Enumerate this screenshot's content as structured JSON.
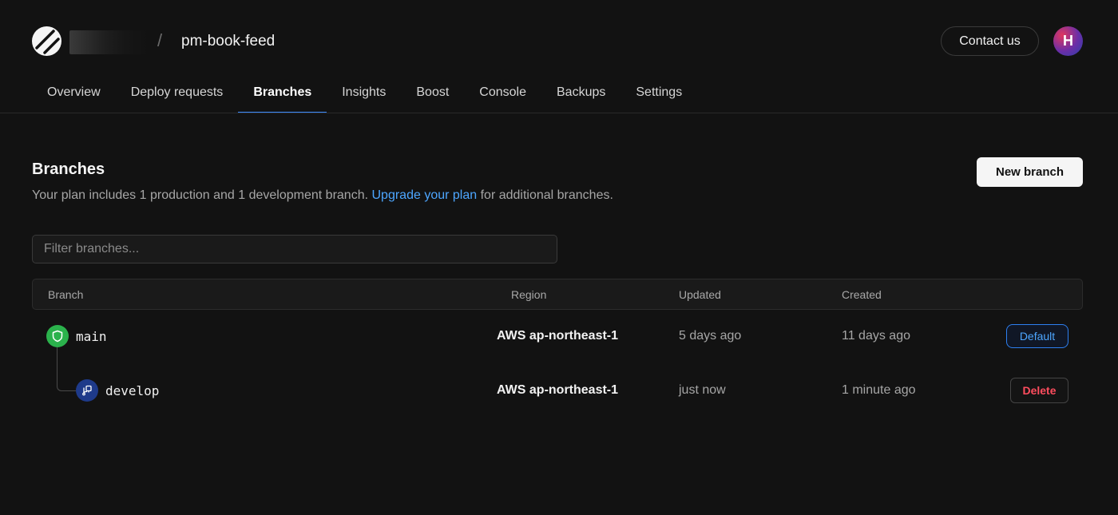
{
  "header": {
    "org_name": "",
    "separator": "/",
    "database": "pm-book-feed",
    "contact_label": "Contact us",
    "avatar_initial": "H"
  },
  "tabs": [
    {
      "label": "Overview",
      "active": false
    },
    {
      "label": "Deploy requests",
      "active": false
    },
    {
      "label": "Branches",
      "active": true
    },
    {
      "label": "Insights",
      "active": false
    },
    {
      "label": "Boost",
      "active": false
    },
    {
      "label": "Console",
      "active": false
    },
    {
      "label": "Backups",
      "active": false
    },
    {
      "label": "Settings",
      "active": false
    }
  ],
  "page": {
    "title": "Branches",
    "plan_text": "Your plan includes 1 production and 1 development branch.",
    "upgrade_link": "Upgrade your plan",
    "plan_suffix": "for additional branches.",
    "new_branch_label": "New branch"
  },
  "filter": {
    "placeholder": "Filter branches...",
    "value": ""
  },
  "table": {
    "columns": [
      "Branch",
      "Region",
      "Updated",
      "Created"
    ],
    "rows": [
      {
        "name": "main",
        "region": "AWS ap-northeast-1",
        "updated": "5 days ago",
        "created": "11 days ago",
        "action": "Default",
        "icon": "shield-icon"
      },
      {
        "name": "develop",
        "region": "AWS ap-northeast-1",
        "updated": "just now",
        "created": "1 minute ago",
        "action": "Delete",
        "icon": "branch-icon"
      }
    ]
  },
  "colors": {
    "background": "#121212",
    "accent_blue": "#3c8cff",
    "production_green": "#2bb24c",
    "development_blue": "#1e3a8a",
    "danger_red": "#ff4d5e"
  }
}
